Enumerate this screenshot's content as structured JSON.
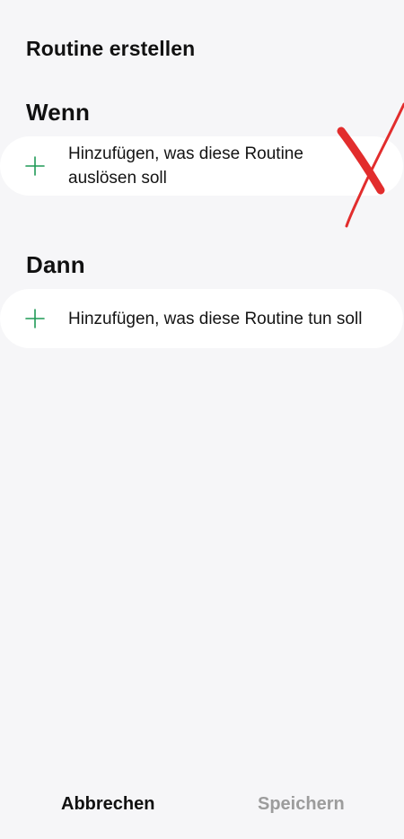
{
  "header": {
    "title": "Routine erstellen"
  },
  "sections": {
    "when": {
      "title": "Wenn",
      "add_text": "Hinzufügen, was diese Routine auslösen soll"
    },
    "then": {
      "title": "Dann",
      "add_text": "Hinzufügen, was diese Routine tun soll"
    }
  },
  "footer": {
    "cancel_label": "Abbrechen",
    "save_label": "Speichern",
    "save_enabled": false
  },
  "icons": {
    "add": "plus-icon"
  },
  "colors": {
    "background": "#f6f6f8",
    "card": "#ffffff",
    "plus_icon": "#1f9a57",
    "disabled_text": "#9c9c9c",
    "annotation": "#e22d2d"
  }
}
